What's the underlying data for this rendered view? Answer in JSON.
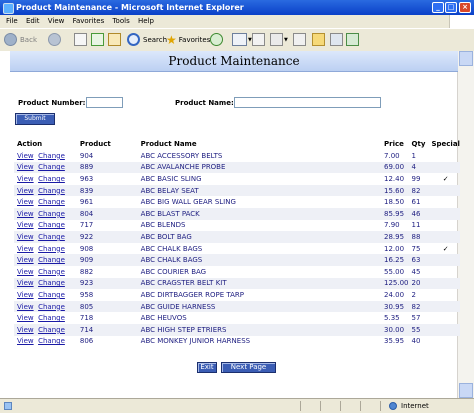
{
  "window": {
    "title": "Product Maintenance - Microsoft Internet Explorer"
  },
  "menu": [
    "File",
    "Edit",
    "View",
    "Favorites",
    "Tools",
    "Help"
  ],
  "toolbar": {
    "back_label": "Back",
    "search_label": "Search",
    "favorites_label": "Favorites"
  },
  "page": {
    "heading": "Product Maintenance",
    "product_number_label": "Product Number:",
    "product_name_label": "Product Name:",
    "submit_label": "Submit"
  },
  "table": {
    "headers": [
      "Action",
      "Product",
      "Product Name",
      "Price",
      "Qty",
      "Special"
    ],
    "view_label": "View",
    "change_label": "Change",
    "rows": [
      {
        "product": "904",
        "name": "ABC ACCESSORY BELTS",
        "price": "7.00",
        "qty": "1",
        "special": ""
      },
      {
        "product": "889",
        "name": "ABC AVALANCHE PROBE",
        "price": "69.00",
        "qty": "4",
        "special": ""
      },
      {
        "product": "963",
        "name": "ABC BASIC SLING",
        "price": "12.40",
        "qty": "99",
        "special": "✓"
      },
      {
        "product": "839",
        "name": "ABC BELAY SEAT",
        "price": "15.60",
        "qty": "82",
        "special": ""
      },
      {
        "product": "961",
        "name": "ABC BIG WALL GEAR SLING",
        "price": "18.50",
        "qty": "61",
        "special": ""
      },
      {
        "product": "804",
        "name": "ABC BLAST PACK",
        "price": "85.95",
        "qty": "46",
        "special": ""
      },
      {
        "product": "717",
        "name": "ABC BLENDS",
        "price": "7.90",
        "qty": "11",
        "special": ""
      },
      {
        "product": "922",
        "name": "ABC BOLT BAG",
        "price": "28.95",
        "qty": "88",
        "special": ""
      },
      {
        "product": "908",
        "name": "ABC CHALK BAGS",
        "price": "12.00",
        "qty": "75",
        "special": "✓"
      },
      {
        "product": "909",
        "name": "ABC CHALK BAGS",
        "price": "16.25",
        "qty": "63",
        "special": ""
      },
      {
        "product": "882",
        "name": "ABC COURIER BAG",
        "price": "55.00",
        "qty": "45",
        "special": ""
      },
      {
        "product": "923",
        "name": "ABC CRAGSTER BELT KIT",
        "price": "125.00",
        "qty": "20",
        "special": ""
      },
      {
        "product": "958",
        "name": "ABC DIRTBAGGER ROPE TARP",
        "price": "24.00",
        "qty": "2",
        "special": ""
      },
      {
        "product": "805",
        "name": "ABC GUIDE HARNESS",
        "price": "30.95",
        "qty": "82",
        "special": ""
      },
      {
        "product": "718",
        "name": "ABC HEUVOS",
        "price": "5.35",
        "qty": "57",
        "special": ""
      },
      {
        "product": "714",
        "name": "ABC HIGH STEP ETRIERS",
        "price": "30.00",
        "qty": "55",
        "special": ""
      },
      {
        "product": "806",
        "name": "ABC MONKEY JUNIOR HARNESS",
        "price": "35.95",
        "qty": "40",
        "special": ""
      }
    ]
  },
  "footer": {
    "exit_label": "Exit",
    "next_label": "Next Page"
  },
  "status": {
    "zone": "Internet"
  }
}
